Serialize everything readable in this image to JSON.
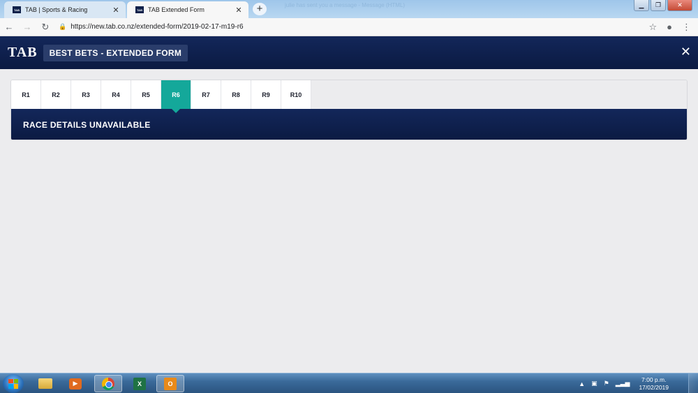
{
  "browser": {
    "tabs": [
      {
        "favicon": "TAB",
        "title": "TAB | Sports & Racing",
        "active": false
      },
      {
        "favicon": "TAB",
        "title": "TAB Extended Form",
        "active": true
      }
    ],
    "new_tab_label": "+",
    "notification_ghost": "julie has sent you a message - Message (HTML)",
    "address": {
      "protocol": "https://",
      "host": "new.tab.co.nz",
      "path": "/extended-form/2019-02-17-m19-r6"
    },
    "icons": {
      "back": "arrow-left-icon",
      "forward": "arrow-right-icon",
      "reload": "reload-icon",
      "lock": "lock-icon",
      "bookmark": "star-icon",
      "profile": "account-icon",
      "menu": "kebab-icon"
    }
  },
  "header": {
    "logo": "TAB",
    "title": "BEST BETS - EXTENDED FORM",
    "close_symbol": "✕"
  },
  "races": {
    "tabs": [
      "R1",
      "R2",
      "R3",
      "R4",
      "R5",
      "R6",
      "R7",
      "R8",
      "R9",
      "R10"
    ],
    "active": "R6",
    "active_color": "#14a89a",
    "details_text": "RACE DETAILS UNAVAILABLE"
  },
  "taskbar": {
    "apps": [
      "file-explorer",
      "media-player",
      "google-chrome",
      "excel",
      "outlook"
    ],
    "active_app": "google-chrome",
    "clock": {
      "time": "7:00 p.m.",
      "date": "17/02/2019"
    }
  }
}
